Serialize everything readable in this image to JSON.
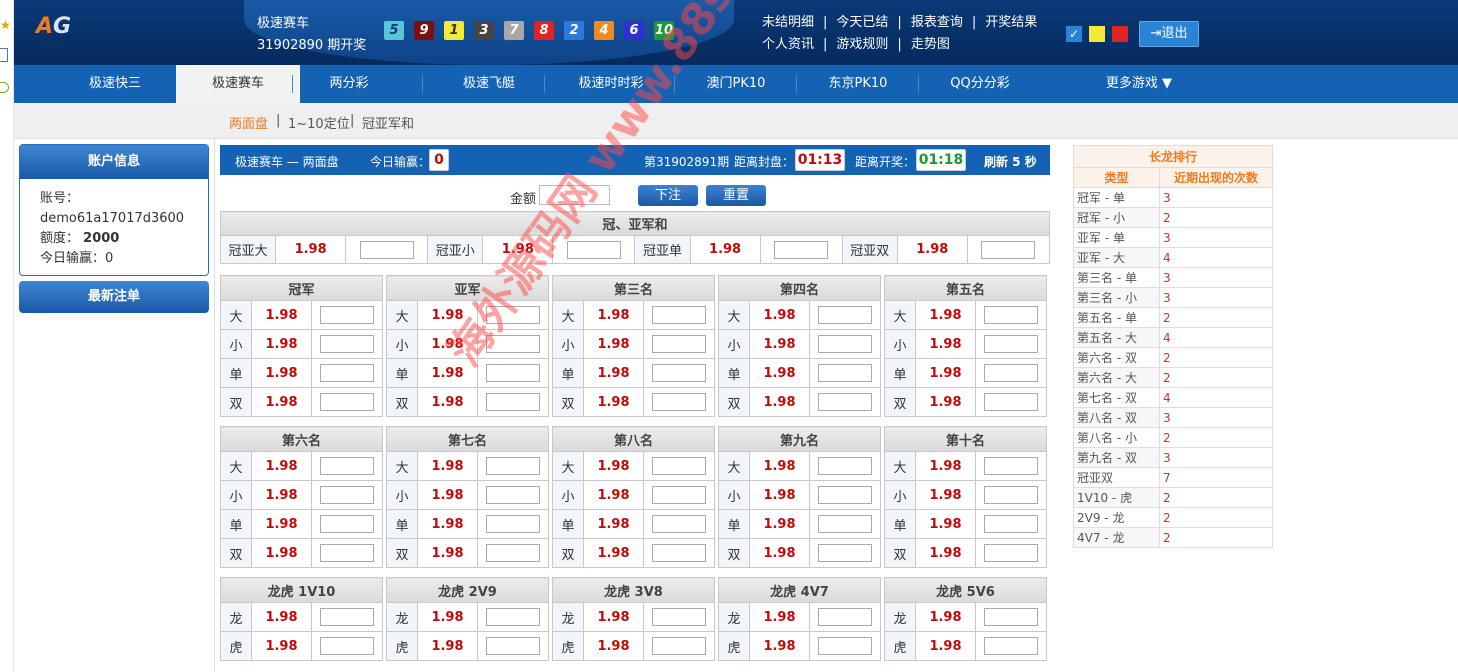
{
  "header": {
    "logo": "AG",
    "game": "极速赛车",
    "period": "31902890 期开奖",
    "balls": [
      {
        "n": "5",
        "bg": "#58c8d8",
        "fg": "#0a3a78"
      },
      {
        "n": "9",
        "bg": "#7a1010",
        "fg": "#fff"
      },
      {
        "n": "1",
        "bg": "#f2e93a",
        "fg": "#333"
      },
      {
        "n": "3",
        "bg": "#444",
        "fg": "#fff"
      },
      {
        "n": "7",
        "bg": "#a8a8a8",
        "fg": "#fff"
      },
      {
        "n": "8",
        "bg": "#e02424",
        "fg": "#fff"
      },
      {
        "n": "2",
        "bg": "#2a78e0",
        "fg": "#fff"
      },
      {
        "n": "4",
        "bg": "#f08a1c",
        "fg": "#fff"
      },
      {
        "n": "6",
        "bg": "#3030d0",
        "fg": "#fff"
      },
      {
        "n": "10",
        "bg": "#1a9a30",
        "fg": "#fff"
      }
    ],
    "links_row1": [
      "未结明细",
      "今天已结",
      "报表查询",
      "开奖结果"
    ],
    "links_row2": [
      "个人资讯",
      "游戏规则",
      "走势图"
    ],
    "swatches": [
      "#2a84d6",
      "#f2e93a",
      "#e02424"
    ],
    "logout": "退出"
  },
  "nav": [
    "极速快三",
    "极速赛车",
    "两分彩",
    "极速飞艇",
    "极速时时彩",
    "澳门PK10",
    "东京PK10",
    "QQ分分彩",
    "更多游戏 ▼"
  ],
  "subnav": [
    "两面盘",
    "1~10定位",
    "冠亚军和"
  ],
  "account": {
    "title": "账户信息",
    "account_label": "账号：",
    "account_value": "demo61a17017d3600",
    "quota_label": "额度：",
    "quota_value": "2000",
    "today_label": "今日输赢：0",
    "recent": "最新注单"
  },
  "infobar": {
    "title": "极速赛车 — 两面盘",
    "today_label": "今日输赢：",
    "today_value": "0",
    "period": "第31902891期",
    "close_label": "距离封盘：",
    "close_time": "01:13",
    "open_label": "距离开奖：",
    "open_time": "01:18",
    "refresh": "刷新 5 秒"
  },
  "bet": {
    "amount_label": "金额",
    "submit": "下注",
    "reset": "重置"
  },
  "sum_section": {
    "title": "冠、亚军和",
    "items": [
      {
        "label": "冠亚大",
        "odds": "1.98"
      },
      {
        "label": "冠亚小",
        "odds": "1.98"
      },
      {
        "label": "冠亚单",
        "odds": "1.98"
      },
      {
        "label": "冠亚双",
        "odds": "1.98"
      }
    ]
  },
  "positions": [
    {
      "title": "冠军"
    },
    {
      "title": "亚军"
    },
    {
      "title": "第三名"
    },
    {
      "title": "第四名"
    },
    {
      "title": "第五名"
    },
    {
      "title": "第六名"
    },
    {
      "title": "第七名"
    },
    {
      "title": "第八名"
    },
    {
      "title": "第九名"
    },
    {
      "title": "第十名"
    }
  ],
  "position_rows": [
    {
      "label": "大",
      "odds": "1.98"
    },
    {
      "label": "小",
      "odds": "1.98"
    },
    {
      "label": "单",
      "odds": "1.98"
    },
    {
      "label": "双",
      "odds": "1.98"
    }
  ],
  "dragon_tiger": [
    {
      "title": "龙虎 1V10"
    },
    {
      "title": "龙虎 2V9"
    },
    {
      "title": "龙虎 3V8"
    },
    {
      "title": "龙虎 4V7"
    },
    {
      "title": "龙虎 5V6"
    }
  ],
  "dt_rows": [
    {
      "label": "龙",
      "odds": "1.98"
    },
    {
      "label": "虎",
      "odds": "1.98"
    }
  ],
  "rank": {
    "title": "长龙排行",
    "col1": "类型",
    "col2": "近期出现的次数",
    "rows": [
      [
        "冠军 - 单",
        "3"
      ],
      [
        "冠军 - 小",
        "2"
      ],
      [
        "亚军 - 单",
        "3"
      ],
      [
        "亚军 - 大",
        "4"
      ],
      [
        "第三名 - 单",
        "3"
      ],
      [
        "第三名 - 小",
        "3"
      ],
      [
        "第五名 - 单",
        "2"
      ],
      [
        "第五名 - 大",
        "4"
      ],
      [
        "第六名 - 双",
        "2"
      ],
      [
        "第六名 - 大",
        "2"
      ],
      [
        "第七名 - 双",
        "4"
      ],
      [
        "第八名 - 双",
        "3"
      ],
      [
        "第八名 - 小",
        "2"
      ],
      [
        "第九名 - 双",
        "3"
      ],
      [
        "冠亚双",
        "7"
      ],
      [
        "1V10 - 虎",
        "2"
      ],
      [
        "2V9 - 龙",
        "2"
      ],
      [
        "4V7 - 龙",
        "2"
      ]
    ]
  },
  "watermark": "海外源码网 www.88shops.top"
}
